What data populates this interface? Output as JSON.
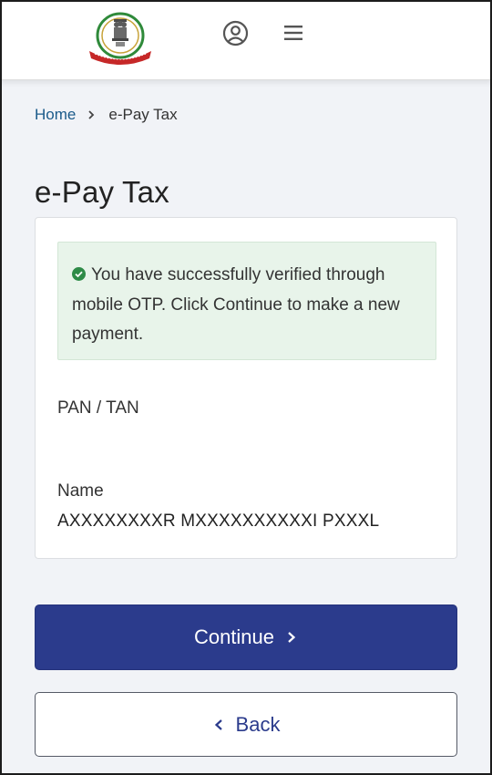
{
  "header": {
    "logo_icon": "income-tax-department-emblem",
    "profile_icon": "user-circle-icon",
    "menu_icon": "hamburger-menu-icon"
  },
  "breadcrumb": {
    "home": "Home",
    "current": "e-Pay Tax"
  },
  "page": {
    "title": "e-Pay Tax"
  },
  "alert": {
    "icon": "check-circle-icon",
    "color": "#2e8b47",
    "message": "You have successfully verified through mobile OTP. Click Continue to make a new payment."
  },
  "fields": {
    "pan_label": "PAN / TAN",
    "pan_value": "",
    "name_label": "Name",
    "name_value": "AXXXXXXXXR MXXXXXXXXXXI PXXXL"
  },
  "buttons": {
    "continue_label": "Continue",
    "back_label": "Back"
  },
  "colors": {
    "primary": "#2b3b8c",
    "link": "#1a5a8a",
    "success_bg": "#e8f4ea"
  }
}
